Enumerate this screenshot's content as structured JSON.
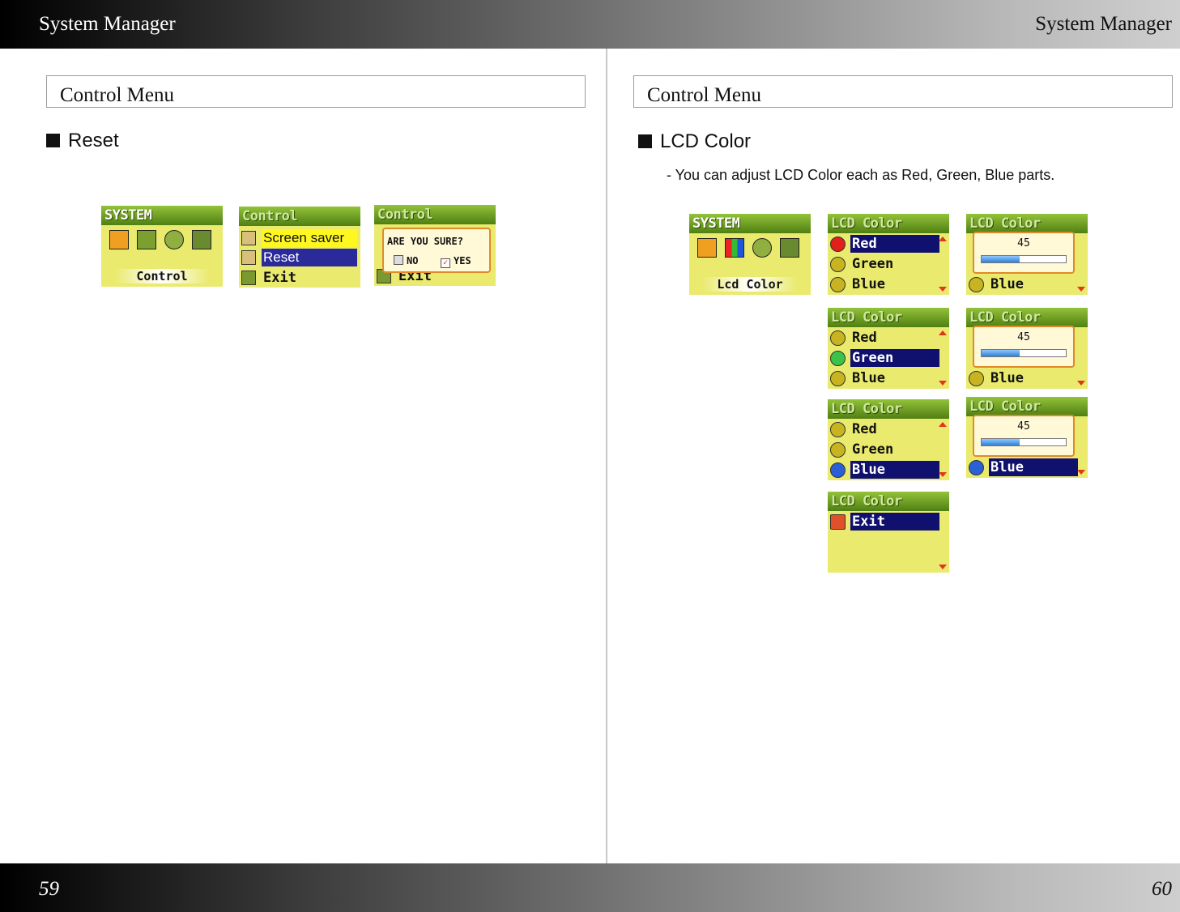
{
  "header": {
    "left_title": "System Manager",
    "right_title": "System Manager"
  },
  "footer": {
    "left_page": "59",
    "right_page": "60"
  },
  "left_page": {
    "section_title": "Control Menu",
    "subheading": "Reset",
    "screens": {
      "system": {
        "title": "SYSTEM",
        "footer": "Control"
      },
      "control": {
        "title": "Control",
        "items": [
          "Screen saver",
          "Reset",
          "Exit"
        ],
        "selected": "Reset"
      },
      "confirm": {
        "title": "Control",
        "question": "ARE YOU SURE?",
        "no": "NO",
        "yes": "YES",
        "behind": "Exit"
      }
    }
  },
  "right_page": {
    "section_title": "Control Menu",
    "subheading": "LCD Color",
    "description": "- You can adjust LCD Color each as Red, Green, Blue parts.",
    "screens": {
      "system": {
        "title": "SYSTEM",
        "footer": "Lcd Color"
      },
      "lcd_title": "LCD Color",
      "items": [
        "Red",
        "Green",
        "Blue"
      ],
      "exit": "Exit",
      "slider_value": "45",
      "slider_fraction": 0.45,
      "colors": {
        "red": "#e0201a",
        "green": "#3bc24a",
        "blue": "#2a5fd6",
        "neutral": "#c8b420"
      }
    }
  }
}
